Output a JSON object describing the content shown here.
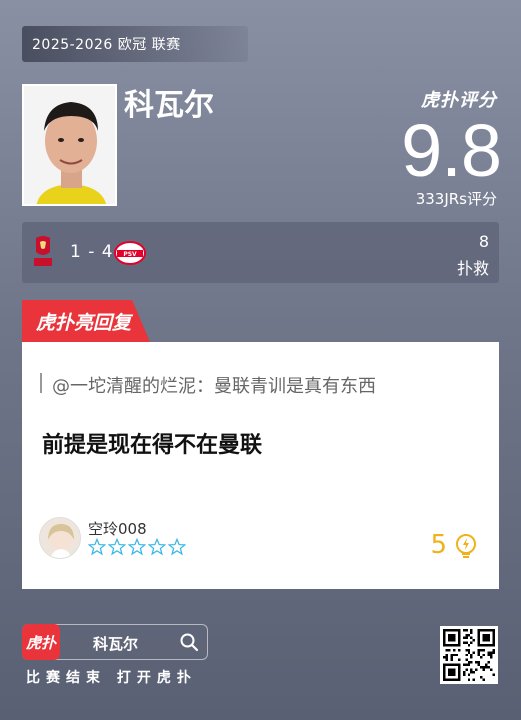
{
  "header": {
    "season": "2025-2026 欧冠 联赛"
  },
  "player": {
    "name": "科瓦尔"
  },
  "rating": {
    "brand": "虎扑评分",
    "score": "9.8",
    "count_label": "333JRs评分"
  },
  "match": {
    "score": "1 - 4",
    "stat_value": "8",
    "stat_label": "扑救"
  },
  "reply": {
    "tag": "虎扑亮回复",
    "quote": "@一坨清醒的烂泥：曼联青训是真有东西",
    "comment": "前提是现在得不在曼联",
    "username": "空玲008",
    "likes": "5"
  },
  "footer": {
    "app_icon_text": "虎扑",
    "search_text": "科瓦尔",
    "caption": "比赛结束 打开虎扑"
  },
  "colors": {
    "accent_red": "#e8343a",
    "like_yellow": "#f0b21a",
    "star_blue": "#38b8e8"
  }
}
